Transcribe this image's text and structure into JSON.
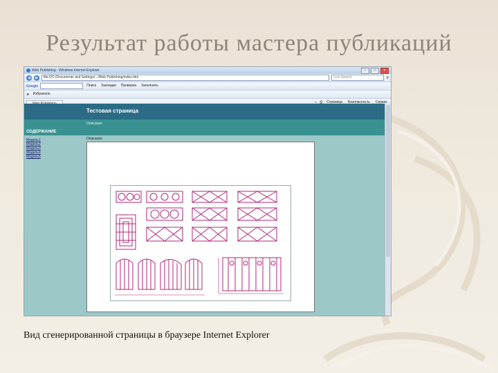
{
  "slide": {
    "title": "Результат работы мастера публикаций",
    "caption": "Вид сгенерированной страницы в браузере Internet Explorer"
  },
  "browser": {
    "window_title": "Web Publishing - Windows Internet Explorer",
    "address": "file:///C:/Documents and Settings/.../Web Publishing/index.htm",
    "search_placeholder": "Live Search",
    "google_label": "Google",
    "toolbar_buttons": [
      "Поиск",
      "Закладки",
      "Проверка",
      "Заполнить"
    ],
    "favorites_label": "Избранное",
    "tab_label": "Web Publishing",
    "tools": [
      "Страница",
      "Безопасность",
      "Сервис"
    ]
  },
  "page": {
    "site_title": "Тестовая страница",
    "site_desc": "Описание",
    "toc_header": "СОДЕРЖАНИЕ",
    "menu": [
      "Модель1",
      "Модель2",
      "Модель3",
      "Модель4",
      "Модель5"
    ],
    "content_label": "Описание"
  },
  "colors": {
    "header_dark": "#2b6b86",
    "header_teal": "#3a9191",
    "page_bg": "#9cc8c8",
    "drawing_ink": "#b0257a"
  }
}
